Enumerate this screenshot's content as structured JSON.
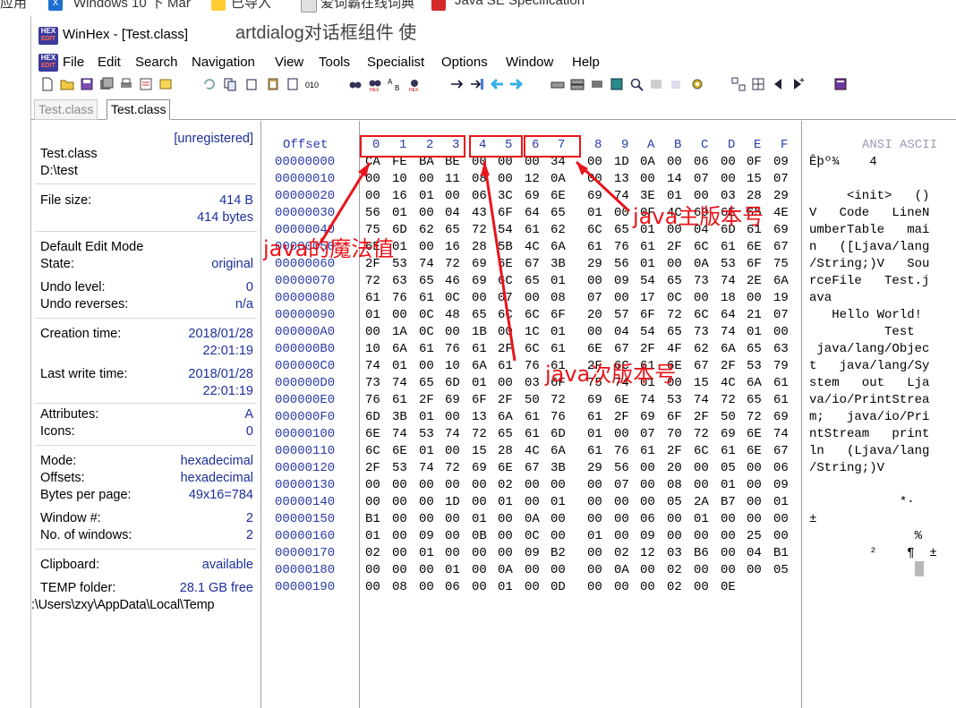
{
  "background": {
    "tabs": [
      "应用",
      "Windows 10 下 Mar",
      "已导入",
      "爱词霸在线词典",
      "Java SE Specification"
    ],
    "behind_text": "artdialog对话框组件 使"
  },
  "window": {
    "title": "WinHex - [Test.class]",
    "logo": "HEX"
  },
  "menu": [
    "File",
    "Edit",
    "Search",
    "Navigation",
    "View",
    "Tools",
    "Specialist",
    "Options",
    "Window",
    "Help"
  ],
  "tabs": [
    {
      "label": "Test.class",
      "active": false
    },
    {
      "label": "Test.class",
      "active": true
    }
  ],
  "info": {
    "registration": "[unregistered]",
    "file_name": "Test.class",
    "file_path": "D:\\test",
    "file_size_label": "File size:",
    "file_size_short": "414 B",
    "file_size_bytes": "414 bytes",
    "edit_mode_label": "Default Edit Mode",
    "state_label": "State:",
    "state_value": "original",
    "undo_level_label": "Undo level:",
    "undo_level_value": "0",
    "undo_reverses_label": "Undo reverses:",
    "undo_reverses_value": "n/a",
    "creation_label": "Creation time:",
    "creation_date": "2018/01/28",
    "creation_time": "22:01:19",
    "lastwrite_label": "Last write time:",
    "lastwrite_date": "2018/01/28",
    "lastwrite_time": "22:01:19",
    "attributes_label": "Attributes:",
    "attributes_value": "A",
    "icons_label": "Icons:",
    "icons_value": "0",
    "mode_label": "Mode:",
    "mode_value": "hexadecimal",
    "offsets_label": "Offsets:",
    "offsets_value": "hexadecimal",
    "bpp_label": "Bytes per page:",
    "bpp_value": "49x16=784",
    "window_no_label": "Window #:",
    "window_no_value": "2",
    "windows_count_label": "No. of windows:",
    "windows_count_value": "2",
    "clipboard_label": "Clipboard:",
    "clipboard_value": "available",
    "temp_label": "TEMP folder:",
    "temp_value": "28.1 GB free",
    "temp_path": ":\\Users\\zxy\\AppData\\Local\\Temp"
  },
  "hexview": {
    "offset_header": "Offset",
    "column_headers": [
      "0",
      "1",
      "2",
      "3",
      "4",
      "5",
      "6",
      "7",
      "8",
      "9",
      "A",
      "B",
      "C",
      "D",
      "E",
      "F"
    ],
    "ascii_header": "ANSI ASCII",
    "rows": [
      {
        "offset": "00000000",
        "hex": "CA FE BA BE 00 00 00 34  00 1D 0A 00 06 00 0F 09",
        "ascii": "Êþº¾    4"
      },
      {
        "offset": "00000010",
        "hex": "00 10 00 11 08 00 12 0A  00 13 00 14 07 00 15 07",
        "ascii": ""
      },
      {
        "offset": "00000020",
        "hex": "00 16 01 00 06 3C 69 6E  69 74 3E 01 00 03 28 29",
        "ascii": "     <init>   ()"
      },
      {
        "offset": "00000030",
        "hex": "56 01 00 04 43 6F 64 65  01 00 0F 4C 69 6E 65 4E",
        "ascii": "V   Code   LineN"
      },
      {
        "offset": "00000040",
        "hex": "75 6D 62 65 72 54 61 62  6C 65 01 00 04 6D 61 69",
        "ascii": "umberTable   mai"
      },
      {
        "offset": "00000050",
        "hex": "6E 01 00 16 28 5B 4C 6A  61 76 61 2F 6C 61 6E 67",
        "ascii": "n   ([Ljava/lang"
      },
      {
        "offset": "00000060",
        "hex": "2F 53 74 72 69 6E 67 3B  29 56 01 00 0A 53 6F 75",
        "ascii": "/String;)V   Sou"
      },
      {
        "offset": "00000070",
        "hex": "72 63 65 46 69 6C 65 01  00 09 54 65 73 74 2E 6A",
        "ascii": "rceFile   Test.j"
      },
      {
        "offset": "00000080",
        "hex": "61 76 61 0C 00 07 00 08  07 00 17 0C 00 18 00 19",
        "ascii": "ava"
      },
      {
        "offset": "00000090",
        "hex": "01 00 0C 48 65 6C 6C 6F  20 57 6F 72 6C 64 21 07",
        "ascii": "   Hello World! "
      },
      {
        "offset": "000000A0",
        "hex": "00 1A 0C 00 1B 00 1C 01  00 04 54 65 73 74 01 00",
        "ascii": "          Test  "
      },
      {
        "offset": "000000B0",
        "hex": "10 6A 61 76 61 2F 6C 61  6E 67 2F 4F 62 6A 65 63",
        "ascii": " java/lang/Objec"
      },
      {
        "offset": "000000C0",
        "hex": "74 01 00 10 6A 61 76 61  2F 6C 61 6E 67 2F 53 79",
        "ascii": "t   java/lang/Sy"
      },
      {
        "offset": "000000D0",
        "hex": "73 74 65 6D 01 00 03 6F  75 74 01 00 15 4C 6A 61",
        "ascii": "stem   out   Lja"
      },
      {
        "offset": "000000E0",
        "hex": "76 61 2F 69 6F 2F 50 72  69 6E 74 53 74 72 65 61",
        "ascii": "va/io/PrintStrea"
      },
      {
        "offset": "000000F0",
        "hex": "6D 3B 01 00 13 6A 61 76  61 2F 69 6F 2F 50 72 69",
        "ascii": "m;   java/io/Pri"
      },
      {
        "offset": "00000100",
        "hex": "6E 74 53 74 72 65 61 6D  01 00 07 70 72 69 6E 74",
        "ascii": "ntStream   print"
      },
      {
        "offset": "00000110",
        "hex": "6C 6E 01 00 15 28 4C 6A  61 76 61 2F 6C 61 6E 67",
        "ascii": "ln   (Ljava/lang"
      },
      {
        "offset": "00000120",
        "hex": "2F 53 74 72 69 6E 67 3B  29 56 00 20 00 05 00 06",
        "ascii": "/String;)V"
      },
      {
        "offset": "00000130",
        "hex": "00 00 00 00 00 02 00 00  00 07 00 08 00 01 00 09",
        "ascii": ""
      },
      {
        "offset": "00000140",
        "hex": "00 00 00 1D 00 01 00 01  00 00 00 05 2A B7 00 01",
        "ascii": "            *·"
      },
      {
        "offset": "00000150",
        "hex": "B1 00 00 00 01 00 0A 00  00 00 06 00 01 00 00 00",
        "ascii": "±"
      },
      {
        "offset": "00000160",
        "hex": "01 00 09 00 0B 00 0C 00  01 00 09 00 00 00 25 00",
        "ascii": "              %"
      },
      {
        "offset": "00000170",
        "hex": "02 00 01 00 00 00 09 B2  00 02 12 03 B6 00 04 B1",
        "ascii": "        ²    ¶  ±"
      },
      {
        "offset": "00000180",
        "hex": "00 00 00 01 00 0A 00 00  00 0A 00 02 00 00 00 05",
        "ascii": ""
      },
      {
        "offset": "00000190",
        "hex": "00 08 00 06 00 01 00 0D  00 00 00 02 00 0E",
        "ascii": ""
      }
    ]
  },
  "annotations": {
    "magic": "java的魔法值",
    "major": "java主版本号",
    "minor": "java次版本号",
    "color": "#e8151b"
  }
}
